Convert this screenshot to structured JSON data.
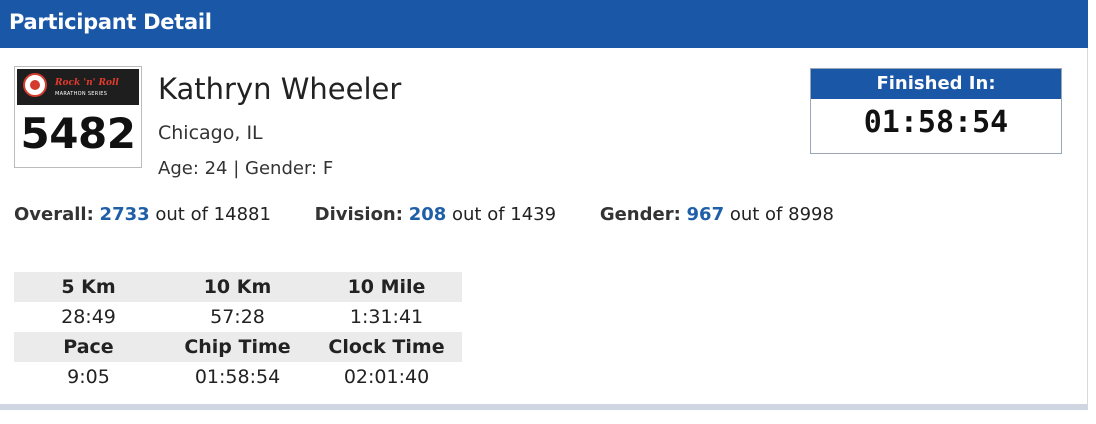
{
  "header": {
    "title": "Participant Detail"
  },
  "bib": {
    "logo_text": "Rock 'n' Roll",
    "logo_subtext": "MARATHON SERIES",
    "number": "5482",
    "logo_color": "#d43a2e"
  },
  "participant": {
    "name": "Kathryn Wheeler",
    "location": "Chicago, IL",
    "age_gender": "Age: 24 | Gender: F"
  },
  "finished": {
    "label": "Finished In:",
    "time": "01:58:54"
  },
  "stats": {
    "overall_label": "Overall:",
    "overall_value": "2733",
    "overall_total": "out of 14881",
    "division_label": "Division:",
    "division_value": "208",
    "division_total": "out of 1439",
    "gender_label": "Gender:",
    "gender_value": "967",
    "gender_total": "out of 8998"
  },
  "splits": {
    "headers1": [
      "5 Km",
      "10 Km",
      "10 Mile"
    ],
    "values1": [
      "28:49",
      "57:28",
      "1:31:41"
    ],
    "headers2": [
      "Pace",
      "Chip Time",
      "Clock Time"
    ],
    "values2": [
      "9:05",
      "01:58:54",
      "02:01:40"
    ]
  },
  "colors": {
    "accent": "#1a57a6",
    "link": "#1f5fa8",
    "table_header_bg": "#ebebeb"
  }
}
